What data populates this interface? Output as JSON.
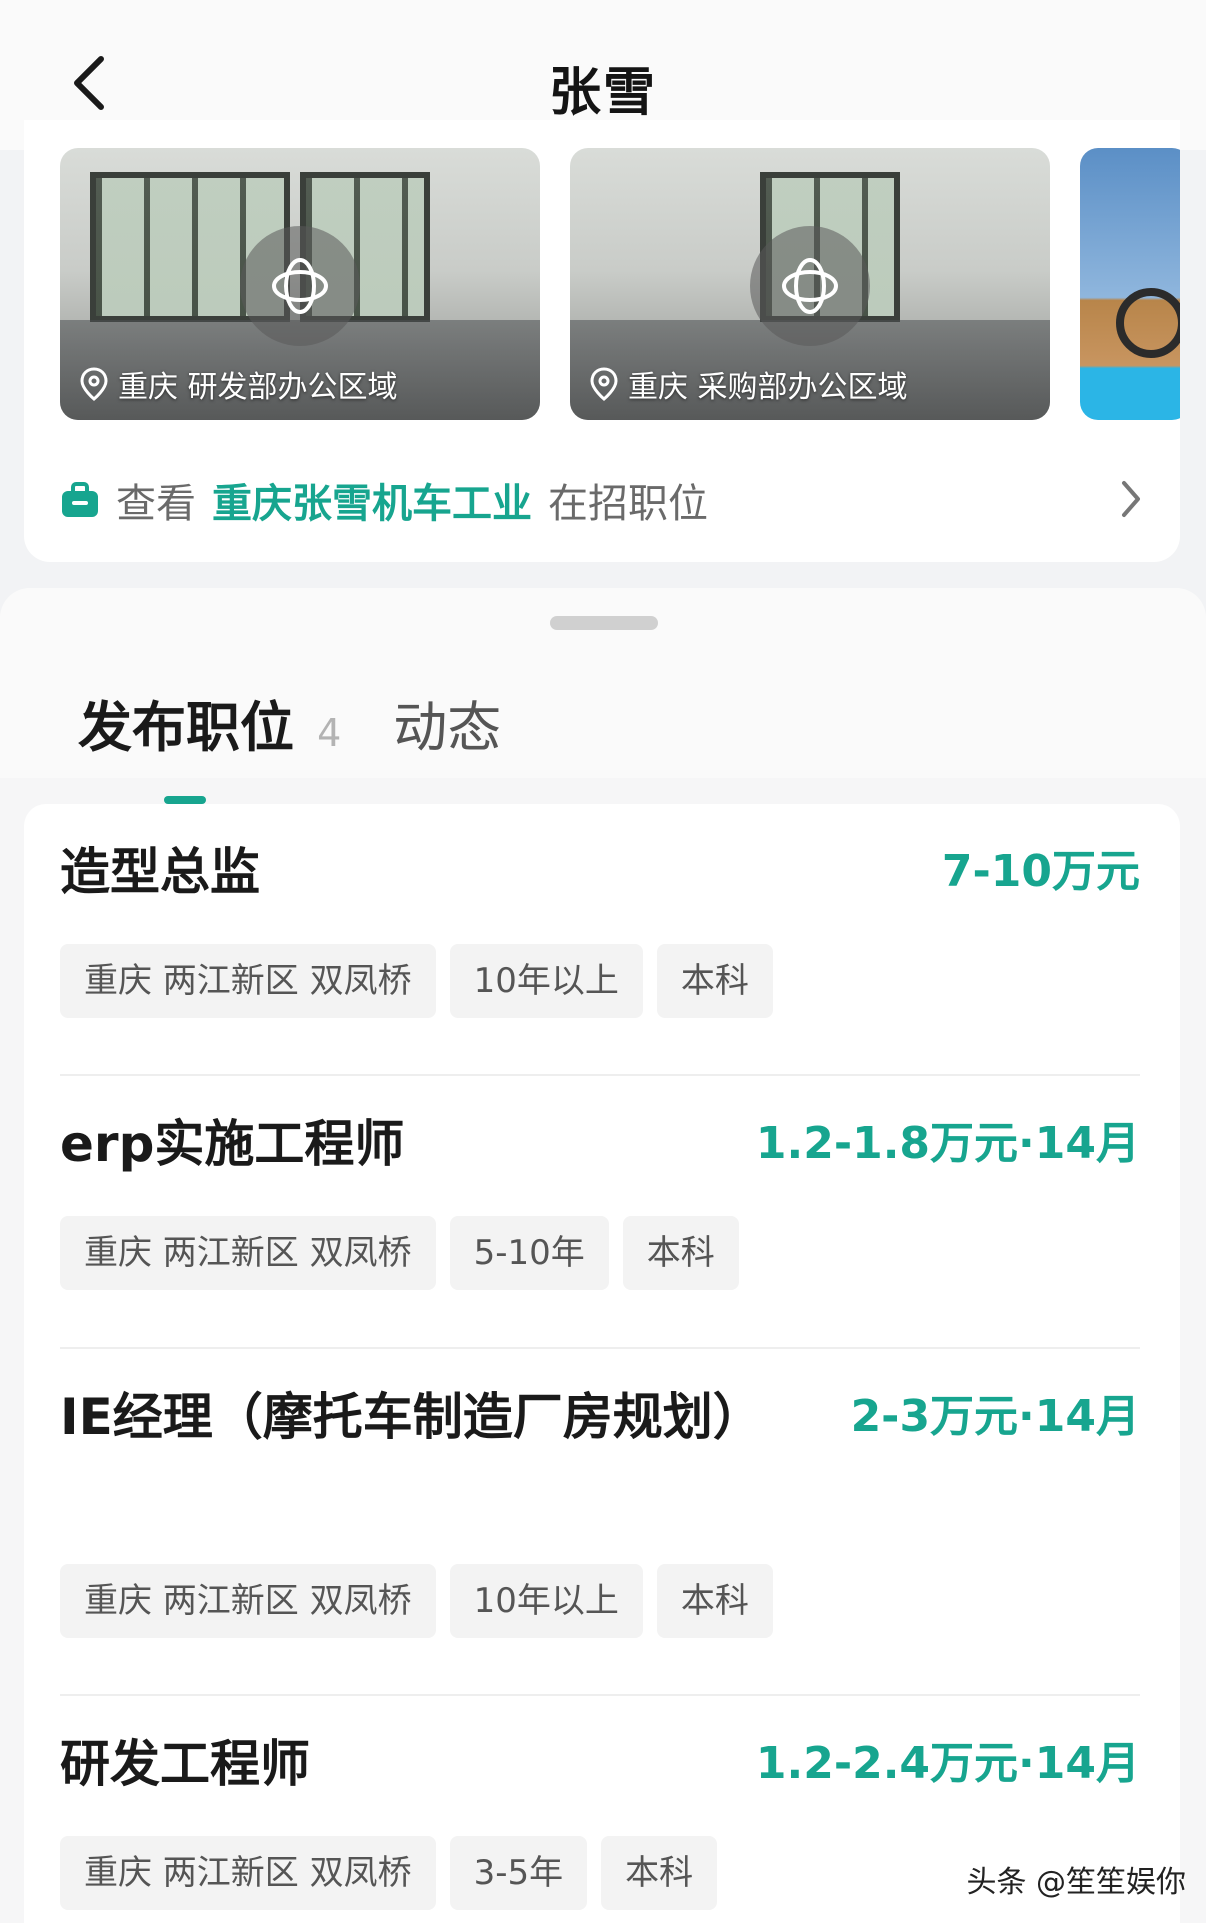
{
  "header": {
    "title": "张雪"
  },
  "gallery": [
    {
      "caption": "重庆 研发部办公区域"
    },
    {
      "caption": "重庆 采购部办公区域"
    }
  ],
  "jobs_link": {
    "pre": "查看",
    "company": "重庆张雪机车工业",
    "post": "在招职位"
  },
  "tabs": {
    "active_label": "发布职位",
    "active_count": "4",
    "other_label": "动态"
  },
  "jobs": [
    {
      "title": "造型总监",
      "salary": "7-10万元",
      "tags": [
        "重庆 两江新区 双凤桥",
        "10年以上",
        "本科"
      ]
    },
    {
      "title": "erp实施工程师",
      "salary": "1.2-1.8万元·14月",
      "tags": [
        "重庆 两江新区 双凤桥",
        "5-10年",
        "本科"
      ]
    },
    {
      "title": "IE经理（摩托车制造厂房规划）",
      "salary": "2-3万元·14月",
      "tags": [
        "重庆 两江新区 双凤桥",
        "10年以上",
        "本科"
      ]
    },
    {
      "title": "研发工程师",
      "salary": "1.2-2.4万元·14月",
      "tags": [
        "重庆 两江新区 双凤桥",
        "3-5年",
        "本科"
      ]
    }
  ],
  "watermark": "头条 @笙笙娱你",
  "colors": {
    "accent": "#17a58f",
    "background": "#f2f3f5"
  }
}
